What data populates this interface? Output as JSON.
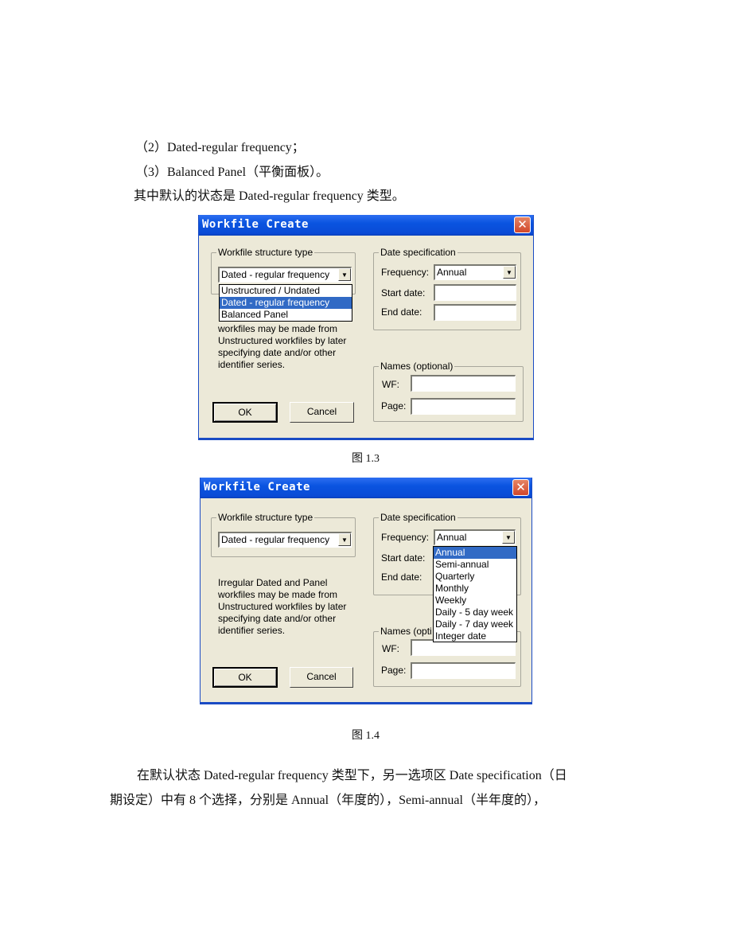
{
  "doc": {
    "line_item2": "（2）Dated-regular frequency；",
    "line_item3": "（3）Balanced Panel（平衡面板）。",
    "line_default": "其中默认的状态是 Dated-regular frequency 类型。",
    "caption1": "图 1.3",
    "caption2": "图 1.4",
    "para_line1": "在默认状态 Dated-regular frequency 类型下，另一选项区 Date specification（日",
    "para_line2": "期设定）中有 8 个选择，分别是 Annual（年度的），Semi-annual（半年度的），"
  },
  "dialog": {
    "title": "Workfile Create",
    "close_glyph": "✕",
    "structure_group_label": "Workfile structure type",
    "structure_selected": "Dated - regular frequency",
    "structure_options": [
      "Unstructured / Undated",
      "Dated - regular frequency",
      "Balanced Panel"
    ],
    "help_lines": [
      "Irregular Dated and Panel",
      "workfiles may be made from",
      "Unstructured workfiles by later",
      "specifying date and/or other",
      "identifier series."
    ],
    "date_group_label": "Date specification",
    "frequency_label": "Frequency:",
    "frequency_selected": "Annual",
    "frequency_options": [
      "Annual",
      "Semi-annual",
      "Quarterly",
      "Monthly",
      "Weekly",
      "Daily - 5 day week",
      "Daily - 7 day week",
      "Integer date"
    ],
    "start_date_label": "Start date:",
    "start_date_value": "",
    "end_date_label": "End date:",
    "end_date_value": "",
    "names_group_label": "Names (optional)",
    "names_group_label_clipped": "Names (opti",
    "wf_label": "WF:",
    "wf_value": "",
    "page_label": "Page:",
    "page_value": "",
    "ok_label": "OK",
    "cancel_label": "Cancel",
    "arrow_glyph": "▼"
  }
}
